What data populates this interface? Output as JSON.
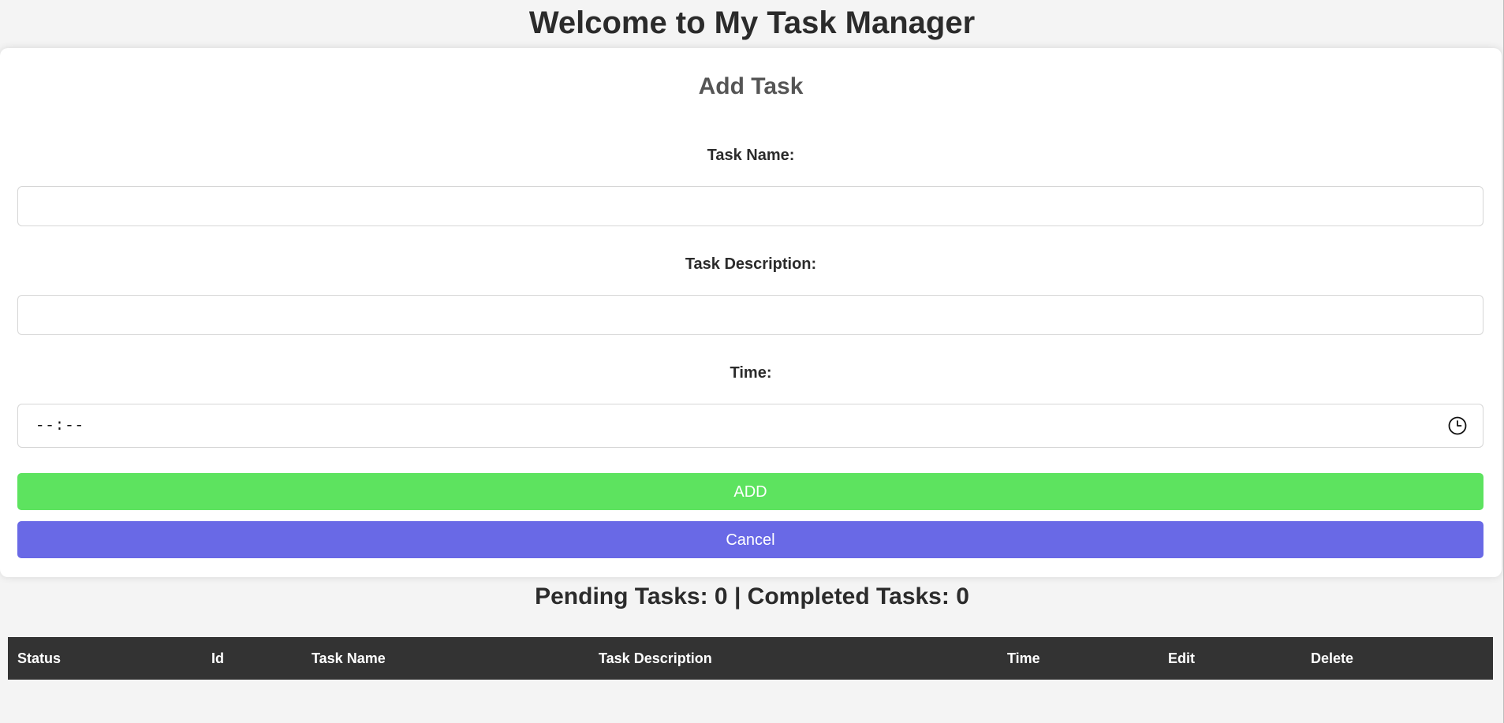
{
  "header": {
    "title": "Welcome to My Task Manager"
  },
  "form": {
    "title": "Add Task",
    "task_name": {
      "label": "Task Name:",
      "value": "",
      "placeholder": ""
    },
    "task_description": {
      "label": "Task Description:",
      "value": "",
      "placeholder": ""
    },
    "time": {
      "label": "Time:",
      "placeholder": "--:--",
      "icon": "clock-icon"
    },
    "add_label": "ADD",
    "cancel_label": "Cancel"
  },
  "summary": {
    "text": "Pending Tasks: 0 | Completed Tasks: 0"
  },
  "table": {
    "columns": [
      "Status",
      "Id",
      "Task Name",
      "Task Description",
      "Time",
      "Edit",
      "Delete"
    ],
    "rows": []
  },
  "colors": {
    "add_button": "#5de35f",
    "cancel_button": "#6969e6",
    "table_header": "#333333",
    "background": "#f4f4f4"
  }
}
